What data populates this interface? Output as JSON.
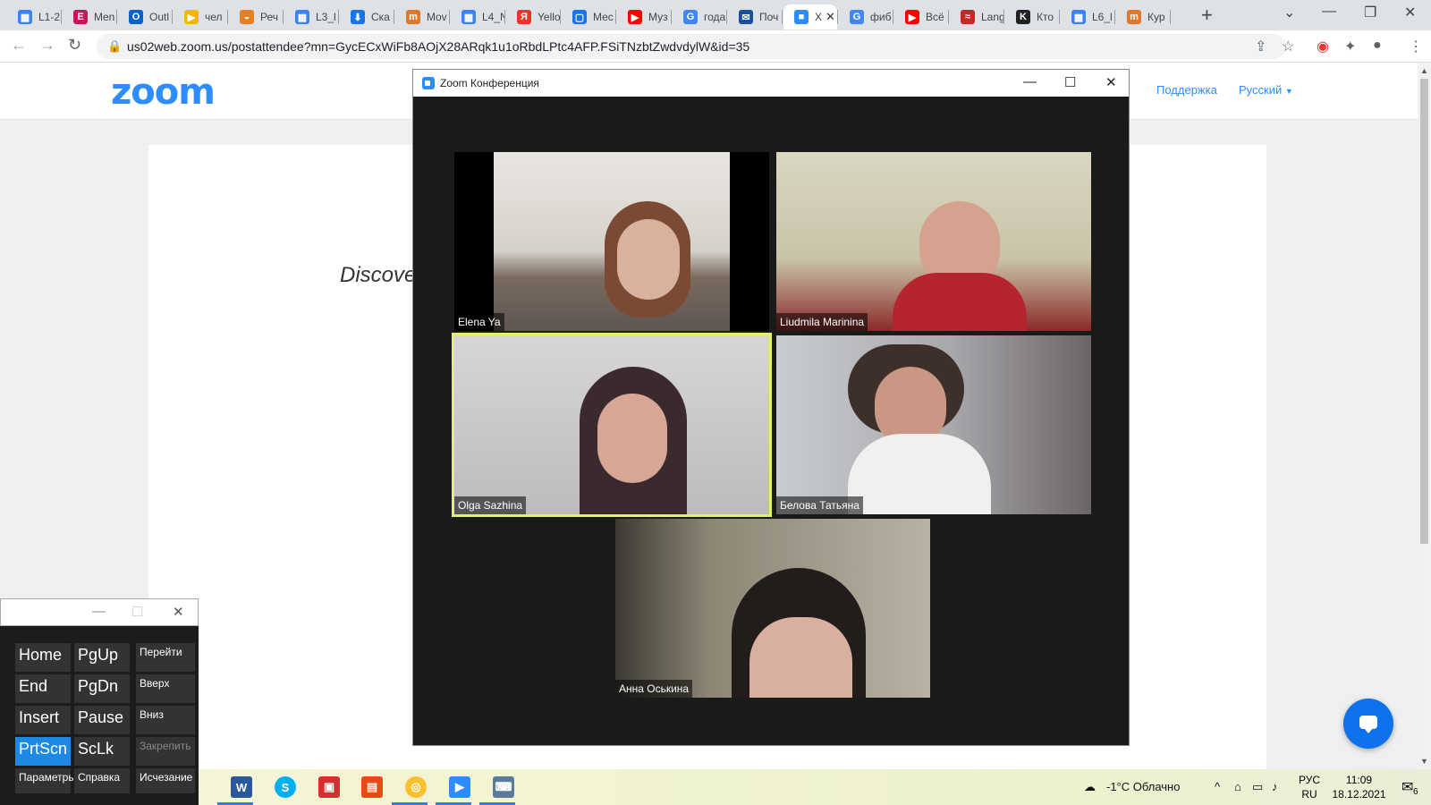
{
  "browser": {
    "tabs": [
      {
        "label": "L1-2",
        "icon": "grid",
        "color": "#3b82f6"
      },
      {
        "label": "Men",
        "icon": "E",
        "color": "#c2185b"
      },
      {
        "label": "Outl",
        "icon": "O",
        "color": "#0b62c4"
      },
      {
        "label": "чел",
        "icon": "play",
        "color": "#f2b705"
      },
      {
        "label": "Реч",
        "icon": "sun",
        "color": "#e67e22"
      },
      {
        "label": "L3_l",
        "icon": "grid",
        "color": "#3b82f6"
      },
      {
        "label": "Ска",
        "icon": "download",
        "color": "#1a73e8"
      },
      {
        "label": "Mov",
        "icon": "m",
        "color": "#e0782c"
      },
      {
        "label": "L4_N",
        "icon": "grid",
        "color": "#3b82f6"
      },
      {
        "label": "Yello",
        "icon": "Я",
        "color": "#f0332a"
      },
      {
        "label": "Мес",
        "icon": "chat",
        "color": "#1a73e8"
      },
      {
        "label": "Муз",
        "icon": "yt",
        "color": "#ff0000"
      },
      {
        "label": "года",
        "icon": "G",
        "color": "#4285f4"
      },
      {
        "label": "Поч",
        "icon": "mail",
        "color": "#1a4f9c"
      },
      {
        "label": "Х",
        "icon": "zoom",
        "color": "#2d8cff"
      },
      {
        "label": "фиб",
        "icon": "G",
        "color": "#4285f4"
      },
      {
        "label": "Всё",
        "icon": "yt",
        "color": "#ff0000"
      },
      {
        "label": "Lang",
        "icon": "book",
        "color": "#c62828"
      },
      {
        "label": "Кто",
        "icon": "K",
        "color": "#222222"
      },
      {
        "label": "L6_l",
        "icon": "grid",
        "color": "#3b82f6"
      },
      {
        "label": "Кур",
        "icon": "m",
        "color": "#e0782c"
      }
    ],
    "url": "us02web.zoom.us/postattendee?mn=GycECxWiFb8AOjX28ARqk1u1oRbdLPtc4AFP.FSiTNzbtZwdvdylW&id=35"
  },
  "page": {
    "logo": "zoom",
    "support_link": "Поддержка",
    "language_link": "Русский",
    "discover_text": "Discove"
  },
  "zoom_window": {
    "title": "Zoom Конференция",
    "participants": [
      {
        "name": "Elena Ya",
        "bg": "#8a8178"
      },
      {
        "name": "Liudmila Marinina",
        "bg": "#c9c4a8"
      },
      {
        "name": "Olga Sazhina",
        "bg": "#b8b6b6"
      },
      {
        "name": "Белова Татьяна",
        "bg": "#a9a8ab"
      },
      {
        "name": "Анна Оськина",
        "bg": "#8c8675"
      }
    ]
  },
  "osk": {
    "keys": [
      [
        "Home",
        "PgUp",
        "Перейти"
      ],
      [
        "End",
        "PgDn",
        "Вверх"
      ],
      [
        "Insert",
        "Pause",
        "Вниз"
      ],
      [
        "PrtScn",
        "ScLk",
        "Закрепить"
      ],
      [
        "Параметры",
        "Справка",
        "Исчезание"
      ]
    ]
  },
  "taskbar": {
    "weather": "-1°C  Облачно",
    "lang_top": "РУС",
    "lang_bottom": "RU",
    "time": "11:09",
    "date": "18.12.2021",
    "notifications": "6"
  }
}
